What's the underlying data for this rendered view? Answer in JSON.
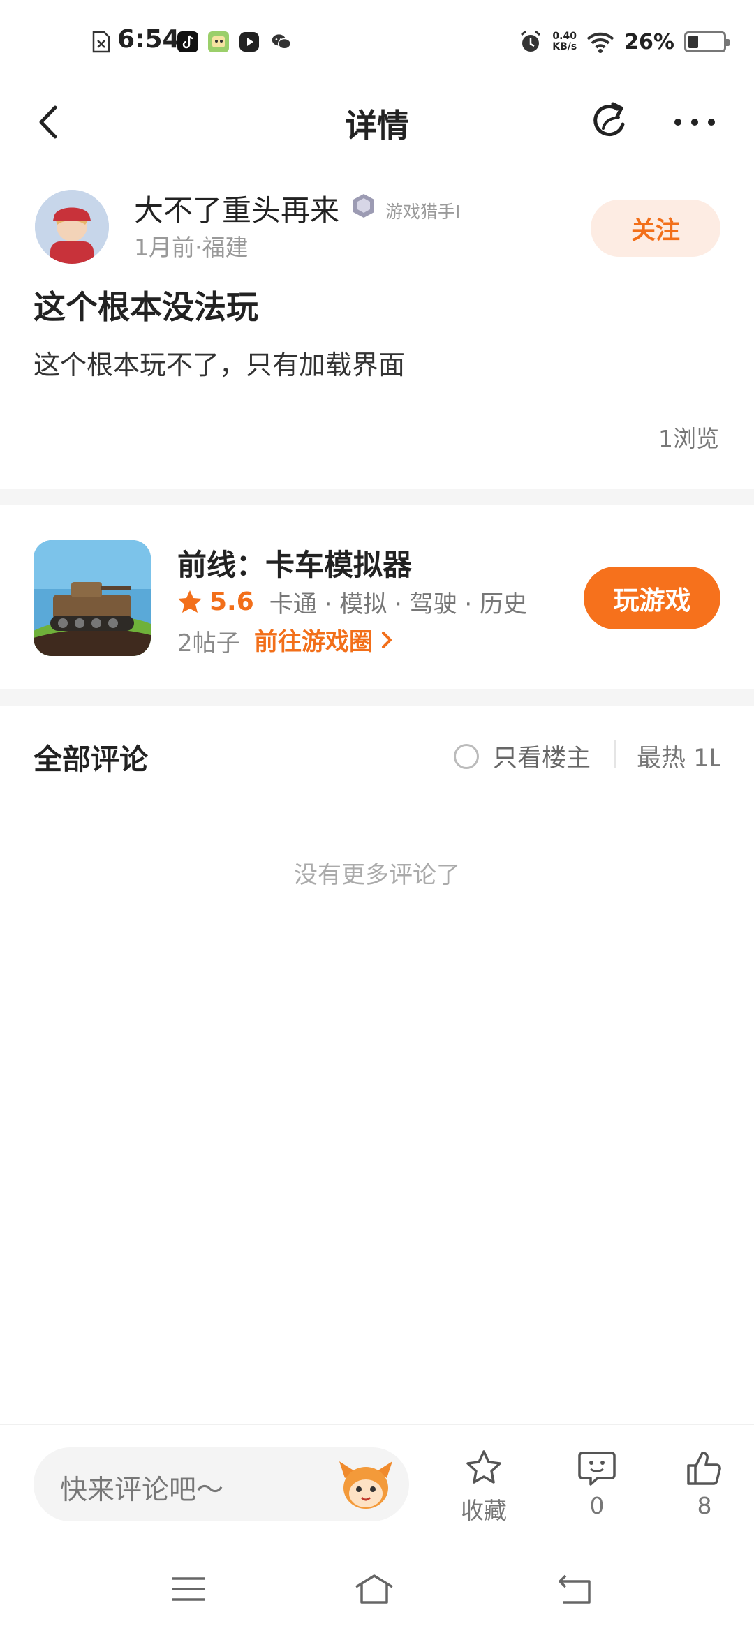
{
  "status_bar": {
    "time": "6:54",
    "net_speed_value": "0.40",
    "net_speed_unit": "KB/s",
    "battery_percent": "26%",
    "battery_level": 0.26
  },
  "nav": {
    "title": "详情"
  },
  "post": {
    "author_name": "大不了重头再来",
    "author_badge": "游戏猎手I",
    "meta": "1月前·福建",
    "follow_label": "关注",
    "title": "这个根本没法玩",
    "body": "这个根本玩不了，只有加载界面",
    "views": "1浏览"
  },
  "game": {
    "name": "前线：卡车模拟器",
    "rating": "5.6",
    "tags": "卡通 · 模拟 · 驾驶 · 历史",
    "posts": "2帖子",
    "circle_link": "前往游戏圈",
    "play_label": "玩游戏"
  },
  "comments": {
    "title": "全部评论",
    "only_op_label": "只看楼主",
    "sort_label": "最热 1L",
    "empty_text": "没有更多评论了"
  },
  "bottom_bar": {
    "input_placeholder": "快来评论吧～",
    "favorite_label": "收藏",
    "comment_count": "0",
    "like_count": "8"
  },
  "colors": {
    "accent": "#f6711c",
    "follow_bg": "#fdece3"
  }
}
